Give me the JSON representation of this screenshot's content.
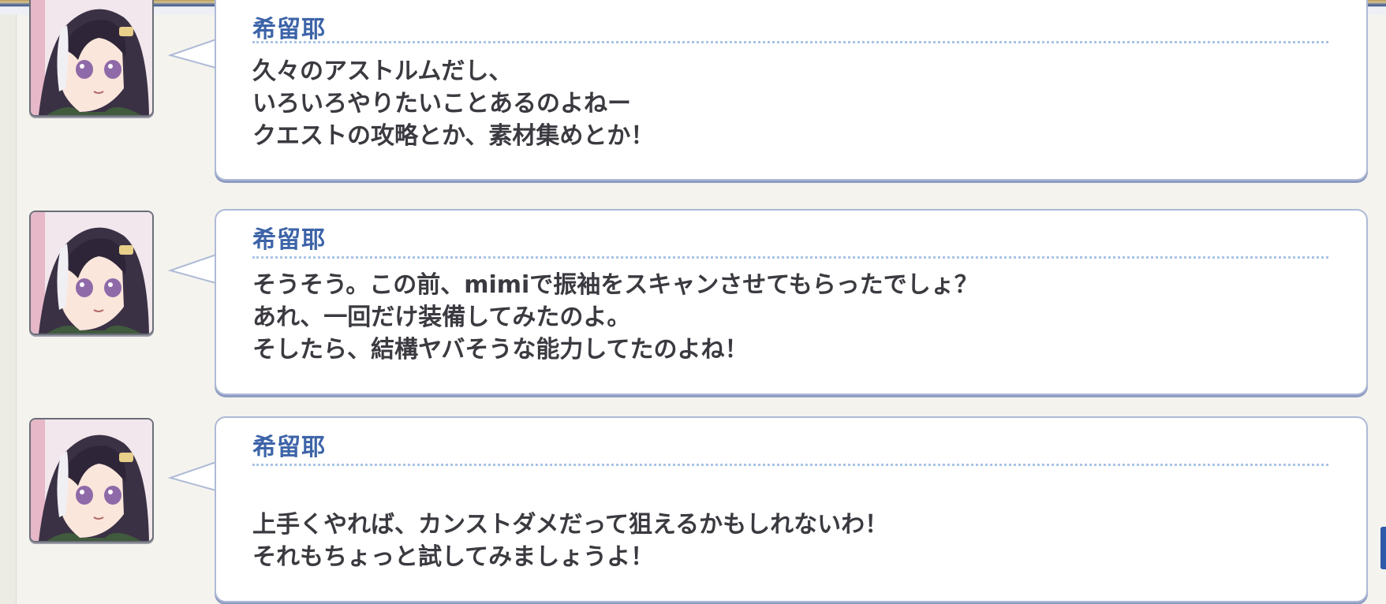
{
  "messages": [
    {
      "speaker": "希留耶",
      "lines": [
        "久々のアストルムだし、",
        "いろいろやりたいことあるのよねー",
        "クエストの攻略とか、素材集めとか！"
      ]
    },
    {
      "speaker": "希留耶",
      "lines": [
        "そうそう。この前、mimiで振袖をスキャンさせてもらったでしょ？",
        "あれ、一回だけ装備してみたのよ。",
        "そしたら、結構ヤバそうな能力してたのよね！"
      ]
    },
    {
      "speaker": "希留耶",
      "lines": [
        "",
        "上手くやれば、カンストダメだって狙えるかもしれないわ！",
        "それもちょっと試してみましょうよ！"
      ]
    }
  ],
  "icons": {
    "avatar": "character-portrait-icon",
    "bubble_tail": "speech-tail-icon"
  },
  "colors": {
    "background": "#f4f3ee",
    "speaker_name": "#3d64a8",
    "dialogue_text": "#3a3a40",
    "bubble_border": "#aebad6",
    "divider": "#a9c3e6",
    "avatar_border": "#6b6e78"
  }
}
